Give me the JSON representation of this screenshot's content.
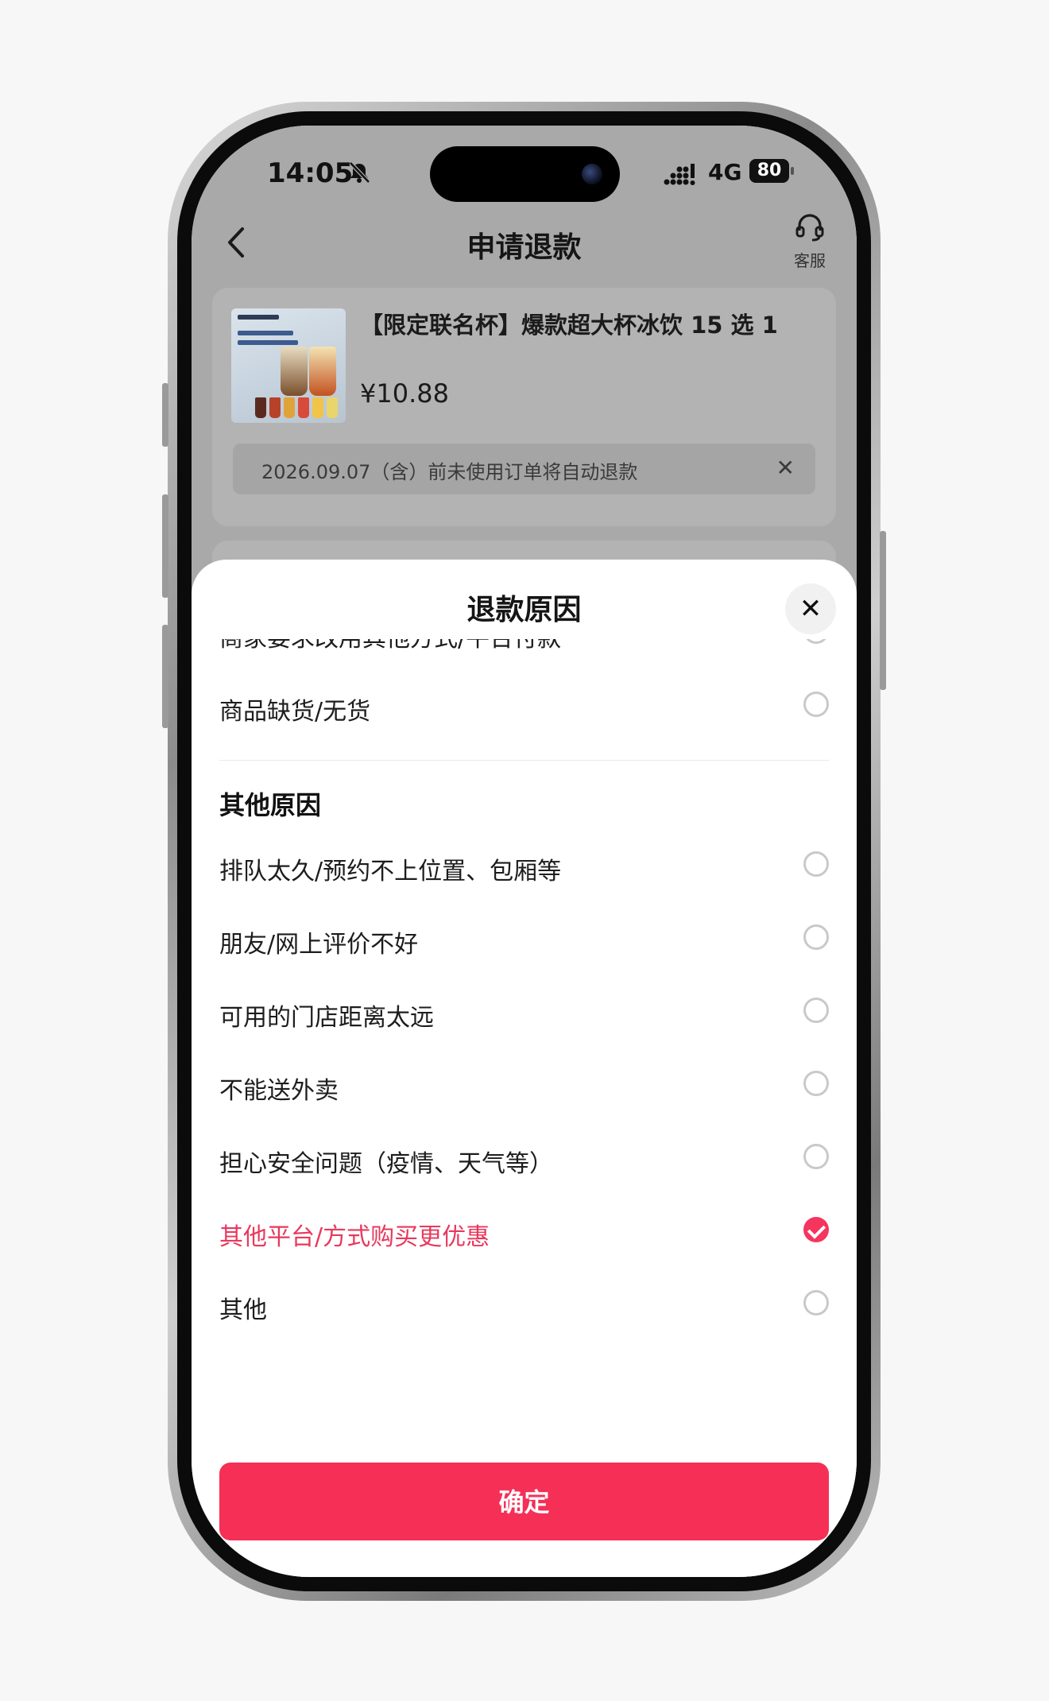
{
  "status_bar": {
    "time": "14:05",
    "network": "4G",
    "battery": "80"
  },
  "nav": {
    "title": "申请退款",
    "service_label": "客服"
  },
  "order": {
    "product_title": "【限定联名杯】爆款超大杯冰饮 15 选 1",
    "price": "¥10.88",
    "notice": "2026.09.07（含）前未使用订单将自动退款"
  },
  "sheet": {
    "title": "退款原因",
    "partial_option": "商家要求改用其他方式/平台付款",
    "options_top": [
      {
        "label": "商品缺货/无货",
        "selected": false
      }
    ],
    "section_title": "其他原因",
    "options": [
      {
        "label": "排队太久/预约不上位置、包厢等",
        "selected": false
      },
      {
        "label": "朋友/网上评价不好",
        "selected": false
      },
      {
        "label": "可用的门店距离太远",
        "selected": false
      },
      {
        "label": "不能送外卖",
        "selected": false
      },
      {
        "label": "担心安全问题（疫情、天气等）",
        "selected": false
      },
      {
        "label": "其他平台/方式购买更优惠",
        "selected": true
      },
      {
        "label": "其他",
        "selected": false
      }
    ],
    "confirm_label": "确定"
  },
  "colors": {
    "accent": "#f52f56",
    "selected_text": "#e8395d",
    "overlay": "#a9a9a9"
  }
}
